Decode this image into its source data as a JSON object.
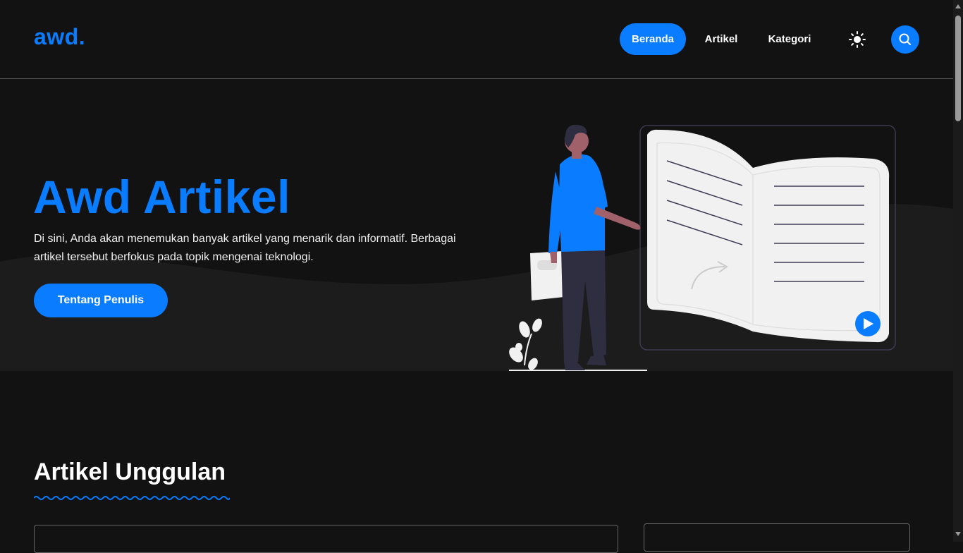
{
  "header": {
    "logo": "awd.",
    "nav": [
      {
        "label": "Beranda",
        "active": true
      },
      {
        "label": "Artikel",
        "active": false
      },
      {
        "label": "Kategori",
        "active": false
      }
    ],
    "theme_icon": "sun-icon",
    "search_icon": "search-icon"
  },
  "hero": {
    "title": "Awd Artikel",
    "description": "Di sini, Anda akan menemukan banyak artikel yang menarik dan informatif. Berbagai artikel tersebut berfokus pada topik mengenai teknologi.",
    "button_label": "Tentang Penulis"
  },
  "featured": {
    "title": "Artikel Unggulan"
  },
  "colors": {
    "accent": "#0a7cff",
    "background": "#121212",
    "hero_wave": "#1c1c1c"
  }
}
